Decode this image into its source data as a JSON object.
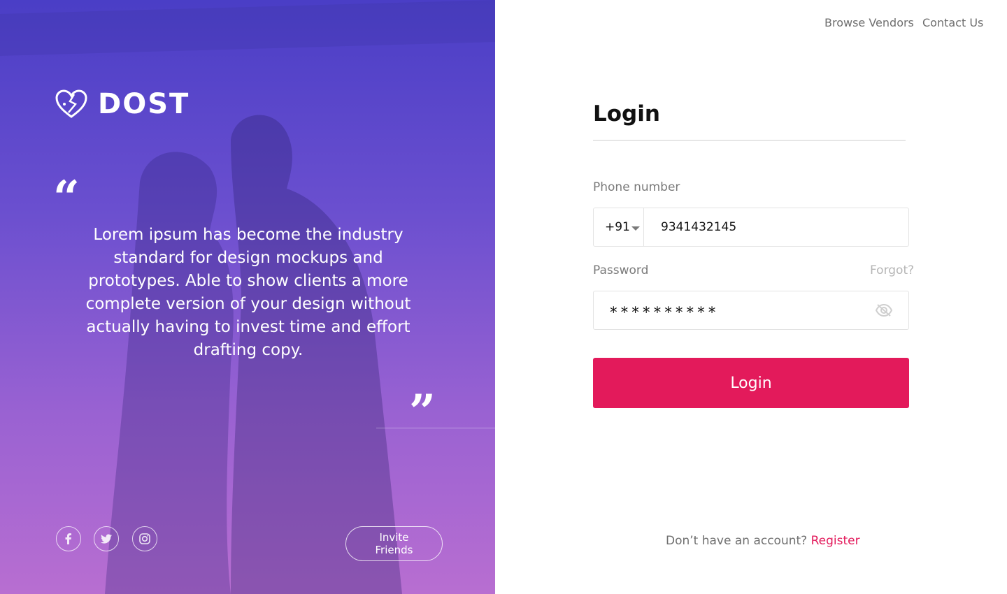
{
  "brand": {
    "name": "DOST"
  },
  "hero": {
    "quote_open": "“",
    "quote": "Lorem ipsum has become the industry standard for design mockups and prototypes. Able to show clients a more complete version of your design without actually having to invest time and effort drafting copy.",
    "quote_close": "”",
    "social": [
      "facebook-icon",
      "twitter-icon",
      "instagram-icon"
    ],
    "invite_label": "Invite Friends"
  },
  "nav": {
    "browse_vendors": "Browse Vendors",
    "contact_us": "Contact Us"
  },
  "login": {
    "title": "Login",
    "phone_label": "Phone number",
    "country_code": "+91",
    "phone_value": "9341432145",
    "password_label": "Password",
    "forgot_label": "Forgot?",
    "password_value": "**********",
    "submit_label": "Login",
    "no_account_text": "Don’t have an account?",
    "register_label": "Register"
  },
  "colors": {
    "accent": "#e31a5b",
    "hero_top": "#4a3ec6",
    "hero_bottom": "#b86ed1"
  }
}
